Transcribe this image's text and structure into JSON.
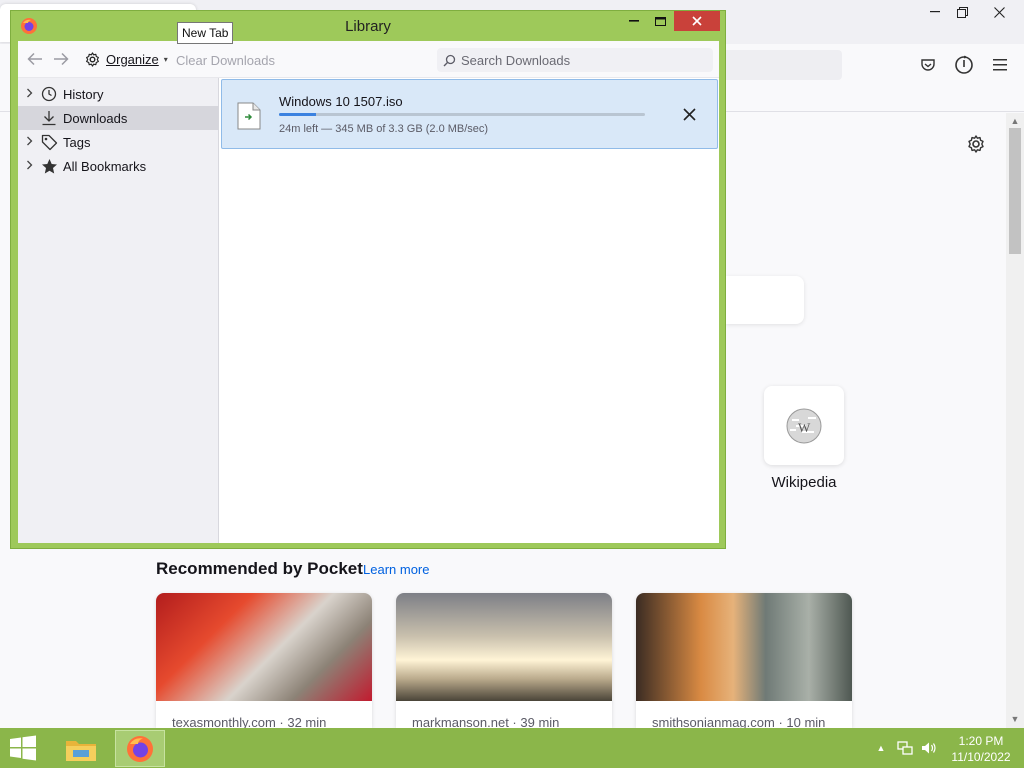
{
  "library": {
    "title": "Library",
    "toolbar": {
      "organize_label": "Organize",
      "clear_downloads_label": "Clear Downloads",
      "search_placeholder": "Search Downloads"
    },
    "sidebar": {
      "items": [
        {
          "label": "History",
          "icon": "clock-icon",
          "expandable": true
        },
        {
          "label": "Downloads",
          "icon": "download-icon",
          "expandable": false,
          "selected": true
        },
        {
          "label": "Tags",
          "icon": "tag-icon",
          "expandable": true
        },
        {
          "label": "All Bookmarks",
          "icon": "star-icon",
          "expandable": true
        }
      ]
    },
    "download": {
      "filename": "Windows 10 1507.iso",
      "status": "24m left — 345 MB of 3.3 GB (2.0 MB/sec)",
      "progress_percent": 10
    }
  },
  "tooltip": {
    "text": "New Tab"
  },
  "firefox": {
    "tile": {
      "label": "Wikipedia"
    },
    "pocket": {
      "title": "Recommended by Pocket",
      "learn_more": "Learn more",
      "cards": [
        {
          "source": "texasmonthly.com · 32 min"
        },
        {
          "source": "markmanson.net · 39 min"
        },
        {
          "source": "smithsonianmag.com · 10 min"
        }
      ]
    }
  },
  "taskbar": {
    "time": "1:20 PM",
    "date": "11/10/2022"
  },
  "colors": {
    "window_accent": "#9ec95a",
    "taskbar": "#8bb64a",
    "close_button": "#c9413a",
    "download_row_bg": "#d9e8f8",
    "progress_fill": "#3b82e0",
    "link": "#0061e0"
  }
}
